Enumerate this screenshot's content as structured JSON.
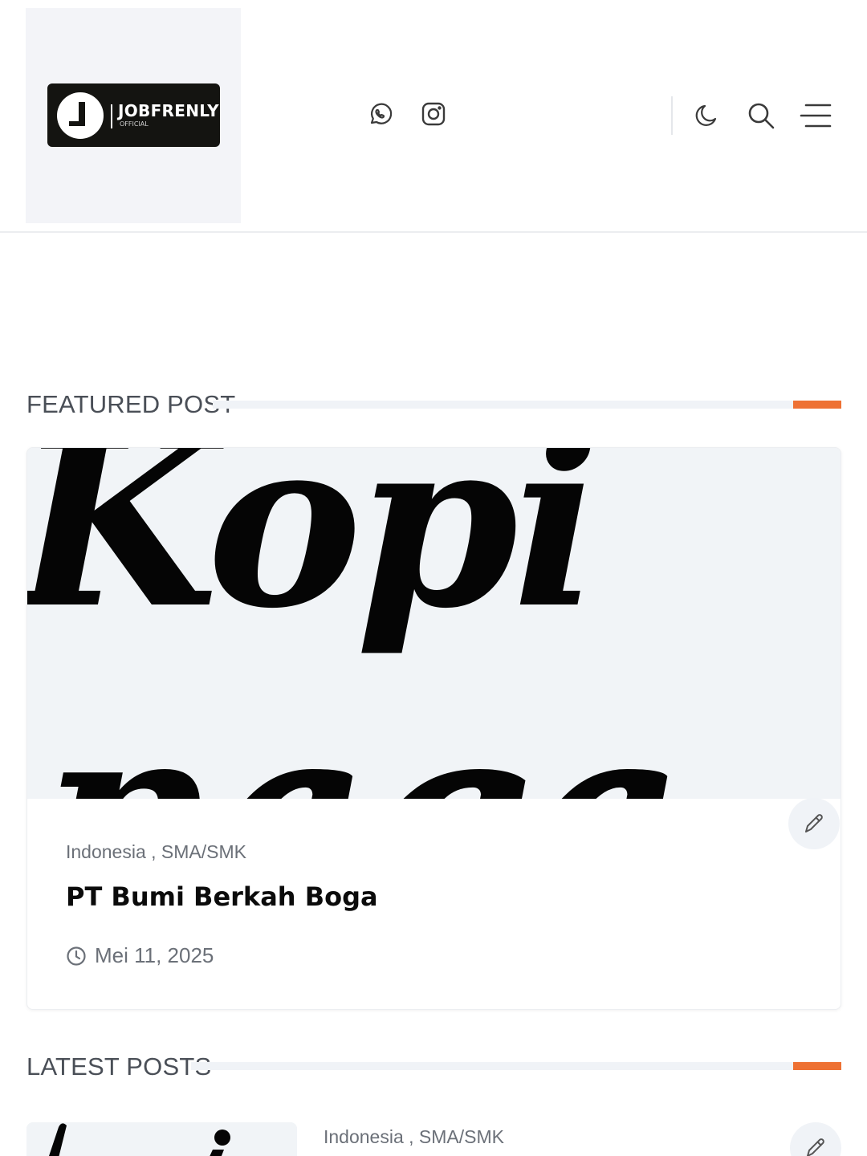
{
  "header": {
    "logo": {
      "title": "JOBFRENLY",
      "subtitle": "OFFICIAL"
    },
    "social": [
      "whatsapp-icon",
      "instagram-icon"
    ],
    "actions": [
      "moon-icon",
      "search-icon",
      "menu-icon"
    ]
  },
  "featured": {
    "section_title": "FEATURED POST",
    "post": {
      "image_text": "Kopi naga",
      "categories": "Indonesia , SMA/SMK",
      "title": "PT Bumi Berkah Boga",
      "date": "Mei 11, 2025"
    }
  },
  "latest": {
    "section_title": "LATEST POSTS",
    "items": [
      {
        "categories": "Indonesia , SMA/SMK"
      }
    ]
  },
  "colors": {
    "accent": "#ee7133",
    "muted_text": "#6b7078",
    "line": "#f0f3f7"
  }
}
